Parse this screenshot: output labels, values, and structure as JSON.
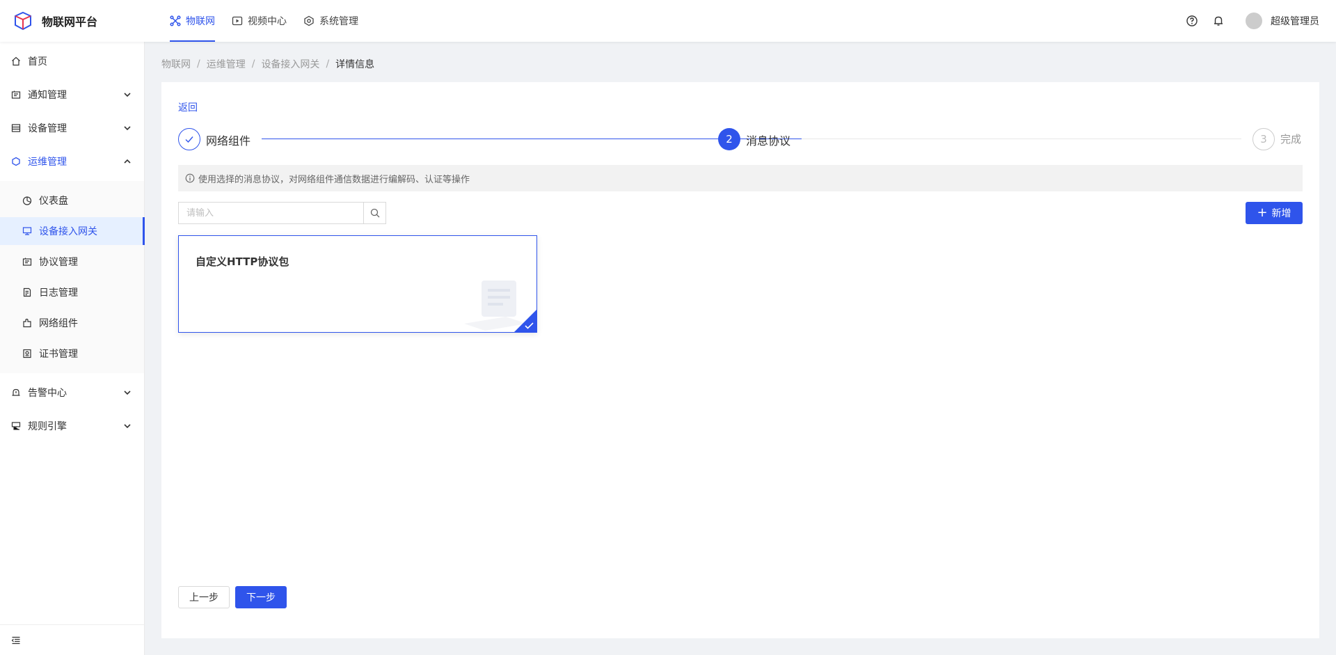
{
  "colors": {
    "primary": "#2f54eb",
    "text": "#333333",
    "muted": "#999999"
  },
  "header": {
    "logo_text": "物联网平台",
    "nav": [
      {
        "label": "物联网",
        "icon": "iot-icon",
        "active": true
      },
      {
        "label": "视频中心",
        "icon": "video-icon",
        "active": false
      },
      {
        "label": "系统管理",
        "icon": "system-icon",
        "active": false
      }
    ],
    "username": "超级管理员"
  },
  "sidebar": {
    "items": [
      {
        "label": "首页",
        "icon": "home-icon"
      },
      {
        "label": "通知管理",
        "icon": "notice-icon"
      },
      {
        "label": "设备管理",
        "icon": "device-icon"
      },
      {
        "label": "运维管理",
        "icon": "ops-icon",
        "open": true
      },
      {
        "label": "告警中心",
        "icon": "alarm-icon"
      },
      {
        "label": "规则引擎",
        "icon": "rule-icon"
      }
    ],
    "sub_items": [
      {
        "label": "仪表盘",
        "icon": "dashboard-icon"
      },
      {
        "label": "设备接入网关",
        "icon": "gateway-icon",
        "selected": true
      },
      {
        "label": "协议管理",
        "icon": "protocol-icon"
      },
      {
        "label": "日志管理",
        "icon": "log-icon"
      },
      {
        "label": "网络组件",
        "icon": "network-icon"
      },
      {
        "label": "证书管理",
        "icon": "certificate-icon"
      }
    ]
  },
  "breadcrumb": [
    "物联网",
    "运维管理",
    "设备接入网关",
    "详情信息"
  ],
  "page": {
    "back_label": "返回",
    "steps": [
      {
        "number": "1",
        "title": "网络组件",
        "status": "finish"
      },
      {
        "number": "2",
        "title": "消息协议",
        "status": "process"
      },
      {
        "number": "3",
        "title": "完成",
        "status": "wait"
      }
    ],
    "alert_text": "使用选择的消息协议，对网络组件通信数据进行编解码、认证等操作",
    "search": {
      "placeholder": "请输入",
      "value": ""
    },
    "add_label": "新增",
    "protocol_cards": [
      {
        "title": "自定义HTTP协议包",
        "selected": true
      }
    ],
    "prev_label": "上一步",
    "next_label": "下一步"
  }
}
